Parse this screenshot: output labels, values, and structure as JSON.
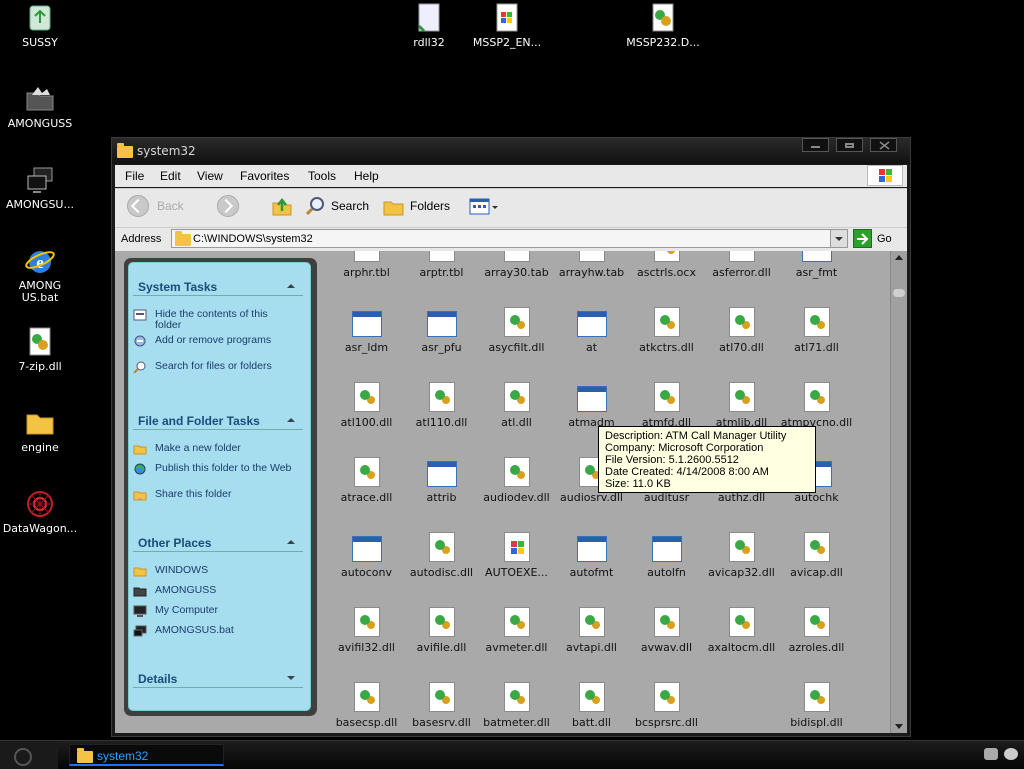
{
  "desktop": {
    "icons": [
      {
        "label": "SUSSY",
        "icon": "recycle-bin-icon"
      },
      {
        "label": "AMONGUSS",
        "icon": "dark-folder-icon"
      },
      {
        "label": "AMONGSU...",
        "icon": "network-computer-icon"
      },
      {
        "label": "AMONG US.bat",
        "icon": "internet-explorer-icon"
      },
      {
        "label": "7-zip.dll",
        "icon": "dll-file-icon"
      },
      {
        "label": "engine",
        "icon": "folder-icon"
      },
      {
        "label": "DataWagon...",
        "icon": "red-molecule-icon"
      },
      {
        "label": "rdll32",
        "icon": "file-icon"
      },
      {
        "label": "MSSP2_EN...",
        "icon": "installer-icon"
      },
      {
        "label": "MSSP232.D...",
        "icon": "dll-file-icon"
      }
    ]
  },
  "window": {
    "title": "system32",
    "menu": [
      "File",
      "Edit",
      "View",
      "Favorites",
      "Tools",
      "Help"
    ],
    "toolbar": {
      "back": "Back",
      "search": "Search",
      "folders": "Folders"
    },
    "address": {
      "label": "Address",
      "value": "C:\\WINDOWS\\system32",
      "go": "Go"
    }
  },
  "taskpane": {
    "system_tasks": {
      "title": "System Tasks",
      "items": [
        "Hide the contents of this folder",
        "Add or remove programs",
        "Search for files or folders"
      ]
    },
    "file_folder_tasks": {
      "title": "File and Folder Tasks",
      "items": [
        "Make a new folder",
        "Publish this folder to the Web",
        "Share this folder"
      ]
    },
    "other_places": {
      "title": "Other Places",
      "items": [
        "WINDOWS",
        "AMONGUSS",
        "My Computer",
        "AMONGSUS.bat"
      ]
    },
    "details": {
      "title": "Details"
    }
  },
  "files": [
    {
      "name": "arphr.tbl",
      "type": "tbl"
    },
    {
      "name": "arptr.tbl",
      "type": "tbl"
    },
    {
      "name": "array30.tab",
      "type": "tbl"
    },
    {
      "name": "arrayhw.tab",
      "type": "tbl"
    },
    {
      "name": "asctrls.ocx",
      "type": "dll"
    },
    {
      "name": "asferror.dll",
      "type": "tbl"
    },
    {
      "name": "asr_fmt",
      "type": "exe"
    },
    {
      "name": "asr_ldm",
      "type": "exe"
    },
    {
      "name": "asr_pfu",
      "type": "exe"
    },
    {
      "name": "asycfilt.dll",
      "type": "dll"
    },
    {
      "name": "at",
      "type": "exe"
    },
    {
      "name": "atkctrs.dll",
      "type": "dll"
    },
    {
      "name": "atl70.dll",
      "type": "dll"
    },
    {
      "name": "atl71.dll",
      "type": "dll"
    },
    {
      "name": "atl100.dll",
      "type": "dll"
    },
    {
      "name": "atl110.dll",
      "type": "dll"
    },
    {
      "name": "atl.dll",
      "type": "dll"
    },
    {
      "name": "atmadm",
      "type": "exe"
    },
    {
      "name": "atmfd.dll",
      "type": "dll"
    },
    {
      "name": "atmlib.dll",
      "type": "dll"
    },
    {
      "name": "atmpvcno.dll",
      "type": "dll"
    },
    {
      "name": "atrace.dll",
      "type": "dll"
    },
    {
      "name": "attrib",
      "type": "exe"
    },
    {
      "name": "audiodev.dll",
      "type": "dll"
    },
    {
      "name": "audiosrv.dll",
      "type": "dll"
    },
    {
      "name": "auditusr",
      "type": "exe"
    },
    {
      "name": "authz.dll",
      "type": "dll"
    },
    {
      "name": "autochk",
      "type": "exe"
    },
    {
      "name": "autoconv",
      "type": "exe"
    },
    {
      "name": "autodisc.dll",
      "type": "dll"
    },
    {
      "name": "AUTOEXE...",
      "type": "app"
    },
    {
      "name": "autofmt",
      "type": "exe"
    },
    {
      "name": "autolfn",
      "type": "exe"
    },
    {
      "name": "avicap32.dll",
      "type": "dll"
    },
    {
      "name": "avicap.dll",
      "type": "dll"
    },
    {
      "name": "avifil32.dll",
      "type": "dll"
    },
    {
      "name": "avifile.dll",
      "type": "dll"
    },
    {
      "name": "avmeter.dll",
      "type": "dll"
    },
    {
      "name": "avtapi.dll",
      "type": "dll"
    },
    {
      "name": "avwav.dll",
      "type": "dll"
    },
    {
      "name": "axaltocm.dll",
      "type": "dll"
    },
    {
      "name": "azroles.dll",
      "type": "dll"
    },
    {
      "name": "basecsp.dll",
      "type": "dll"
    },
    {
      "name": "basesrv.dll",
      "type": "dll"
    },
    {
      "name": "batmeter.dll",
      "type": "dll"
    },
    {
      "name": "batt.dll",
      "type": "dll"
    },
    {
      "name": "bcsprsrc.dll",
      "type": "dll"
    },
    {
      "name": "",
      "type": "blank"
    },
    {
      "name": "bidispl.dll",
      "type": "dll"
    }
  ],
  "tooltip": {
    "description": "Description: ATM Call Manager Utility",
    "company": "Company: Microsoft Corporation",
    "version": "File Version: 5.1.2600.5512",
    "created": "Date Created: 4/14/2008 8:00 AM",
    "size": "Size: 11.0 KB"
  },
  "taskbar": {
    "app_title": "system32"
  },
  "colors": {
    "taskpane_bg": "#a6def0",
    "taskpane_heading": "#1b4c78",
    "content_bg": "#a9a9a9",
    "taskbar_accent": "#29a0ff"
  }
}
